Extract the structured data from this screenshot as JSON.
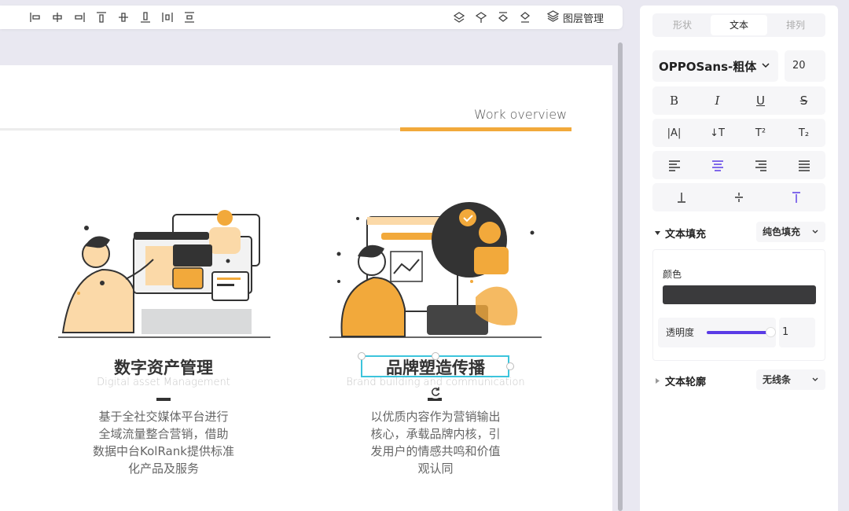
{
  "toolbar": {
    "icons": [
      "align-left-icon",
      "align-center-h-icon",
      "align-right-icon",
      "align-top-icon",
      "align-middle-v-icon",
      "align-bottom-icon",
      "distribute-horizontal-icon",
      "distribute-vertical-icon",
      "bring-forward-icon",
      "send-backward-icon",
      "bring-to-front-icon",
      "send-to-back-icon"
    ],
    "layers_label": "图层管理"
  },
  "slide": {
    "header_label": "Work overview",
    "columns": [
      {
        "title": "数字资产管理",
        "subtitle": "Digital asset Management",
        "desc_lines": [
          "基于全社交媒体平台进行",
          "全域流量整合营销，借助",
          "数据中台KolRank提供标准",
          "化产品及服务"
        ]
      },
      {
        "title": "品牌塑造传播",
        "subtitle": "Brand building and communication",
        "desc_lines": [
          "以优质内容作为营销输出",
          "核心，承载品牌内核，引",
          "发用户的情感共鸣和价值",
          "观认同"
        ]
      }
    ]
  },
  "panel": {
    "tabs": [
      {
        "label": "形状",
        "active": false
      },
      {
        "label": "文本",
        "active": true
      },
      {
        "label": "排列",
        "active": false
      }
    ],
    "font_family": "OPPOSans-粗体",
    "font_size": "20",
    "style_row": [
      "bold-icon",
      "italic-icon",
      "underline-icon",
      "strikethrough-icon"
    ],
    "style_labels": [
      "B",
      "I",
      "U",
      "S"
    ],
    "spacing_row": [
      "letter-spacing-icon",
      "line-height-icon",
      "superscript-icon",
      "subscript-icon"
    ],
    "spacing_labels": [
      "|A|",
      "↓T",
      "T²",
      "T₂"
    ],
    "align_row": [
      "align-text-left-icon",
      "align-text-center-icon",
      "align-text-right-icon",
      "align-text-justify-icon"
    ],
    "valign_row": [
      "valign-bottom-icon",
      "valign-middle-icon",
      "valign-top-icon"
    ],
    "text_fill": {
      "heading": "文本填充",
      "mode": "纯色填充",
      "color_label": "颜色",
      "color": "#3a3a3c",
      "opacity_label": "透明度",
      "opacity": "1"
    },
    "text_outline": {
      "heading": "文本轮廓",
      "mode": "无线条"
    },
    "accent": "#5a3be6"
  }
}
